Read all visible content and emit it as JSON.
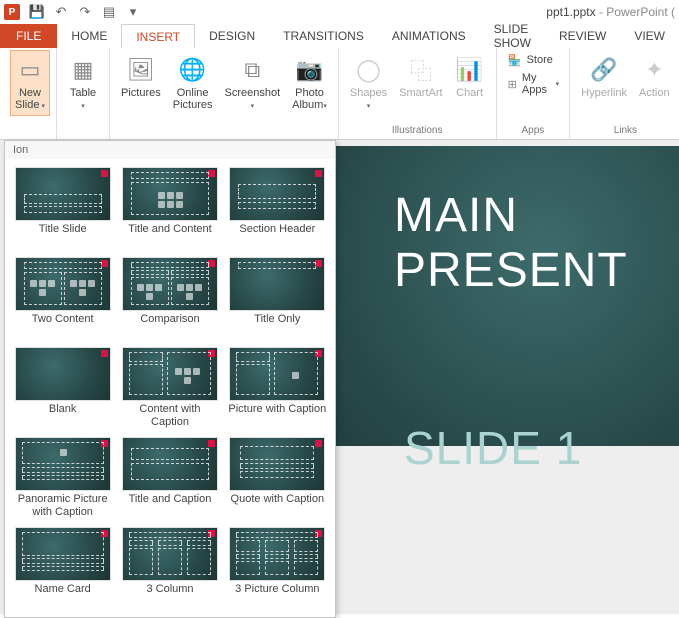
{
  "app": {
    "icon_letter": "P",
    "document_name": "ppt1.pptx",
    "suffix": " - PowerPoint ("
  },
  "qat": {
    "save": "💾",
    "undo": "↶",
    "redo": "↷",
    "start": "▤",
    "customize": "▾"
  },
  "tabs": {
    "file": "FILE",
    "home": "HOME",
    "insert": "INSERT",
    "design": "DESIGN",
    "transitions": "TRANSITIONS",
    "animations": "ANIMATIONS",
    "slideshow": "SLIDE SHOW",
    "review": "REVIEW",
    "view": "VIEW"
  },
  "ribbon": {
    "new_slide": "New\nSlide",
    "table": "Table",
    "pictures": "Pictures",
    "online_pictures": "Online\nPictures",
    "screenshot": "Screenshot",
    "photo_album": "Photo\nAlbum",
    "shapes": "Shapes",
    "smartart": "SmartArt",
    "chart": "Chart",
    "store": "Store",
    "myapps": "My Apps",
    "hyperlink": "Hyperlink",
    "action": "Action",
    "group_illustrations": "Illustrations",
    "group_apps": "Apps",
    "group_links": "Links"
  },
  "dropdown": {
    "theme": "Ion",
    "layouts": [
      {
        "name": "Title Slide"
      },
      {
        "name": "Title and Content"
      },
      {
        "name": "Section Header"
      },
      {
        "name": "Two Content"
      },
      {
        "name": "Comparison"
      },
      {
        "name": "Title Only"
      },
      {
        "name": "Blank"
      },
      {
        "name": "Content with Caption"
      },
      {
        "name": "Picture with Caption"
      },
      {
        "name": "Panoramic Picture with Caption"
      },
      {
        "name": "Title and Caption"
      },
      {
        "name": "Quote with Caption"
      },
      {
        "name": "Name Card"
      },
      {
        "name": "3 Column"
      },
      {
        "name": "3 Picture Column"
      }
    ]
  },
  "slide": {
    "title_line1": "MAIN",
    "title_line2": "PRESENT",
    "subtitle": "SLIDE 1"
  }
}
